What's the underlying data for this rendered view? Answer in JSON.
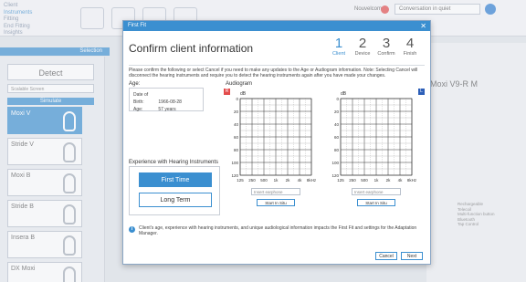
{
  "nav": {
    "client_label": "Client",
    "items": [
      "Instruments",
      "Fitting",
      "End Fitting",
      "Insights"
    ]
  },
  "top": {
    "status_label": "Nouvelcome",
    "program_select": "Conversation in quiet"
  },
  "sidebar": {
    "section_label": "Selection",
    "detect_label": "Detect",
    "select_placeholder": "Scalable Screen",
    "simulate_label": "Simulate",
    "items": [
      "Moxi V",
      "Stride V",
      "Moxi B",
      "Stride B",
      "Insera B",
      "DX Moxi"
    ]
  },
  "right_panel": {
    "title": "Moxi V9-R M",
    "notes": [
      "Rechargeable",
      "Telecoil",
      "Multi-function button",
      "Bluetooth",
      "Tap Control"
    ]
  },
  "modal": {
    "window_title": "First Fit",
    "heading": "Confirm client information",
    "steps": [
      {
        "num": "1",
        "label": "Client"
      },
      {
        "num": "2",
        "label": "Device"
      },
      {
        "num": "3",
        "label": "Confirm"
      },
      {
        "num": "4",
        "label": "Finish"
      }
    ],
    "instructions": "Please confirm the following or select Cancel if you need to make any updates to the Age or Audiogram information. Note: Selecting Cancel will disconnect the hearing instruments and require you to detect the hearing instruments again after you have made your changes.",
    "age": {
      "label": "Age:",
      "dob_key": "Date of Birth:",
      "dob_value": "1966-08-28",
      "age_key": "Age:",
      "age_value": "57 years"
    },
    "experience": {
      "label": "Experience with Hearing Instruments",
      "first_time": "First Time",
      "long_term": "Long Term"
    },
    "audiogram": {
      "label": "Audiogram",
      "right_badge": "R",
      "left_badge": "L",
      "unit": "dB",
      "y_ticks": [
        "0",
        "20",
        "40",
        "60",
        "80",
        "100",
        "120"
      ],
      "x_ticks": [
        "125",
        "250",
        "500",
        "1k",
        "2k",
        "4k",
        "8kHz"
      ],
      "right_color": "#e34b4b",
      "left_color": "#2d5fb8",
      "earphone_placeholder": "Insert earphone",
      "insitu_label": "Start In Situ"
    },
    "info_text": "Client's age, experience with hearing instruments, and unique audiological information impacts the First Fit and settings for the Adaptation Manager.",
    "cancel_label": "Cancel",
    "next_label": "Next"
  }
}
